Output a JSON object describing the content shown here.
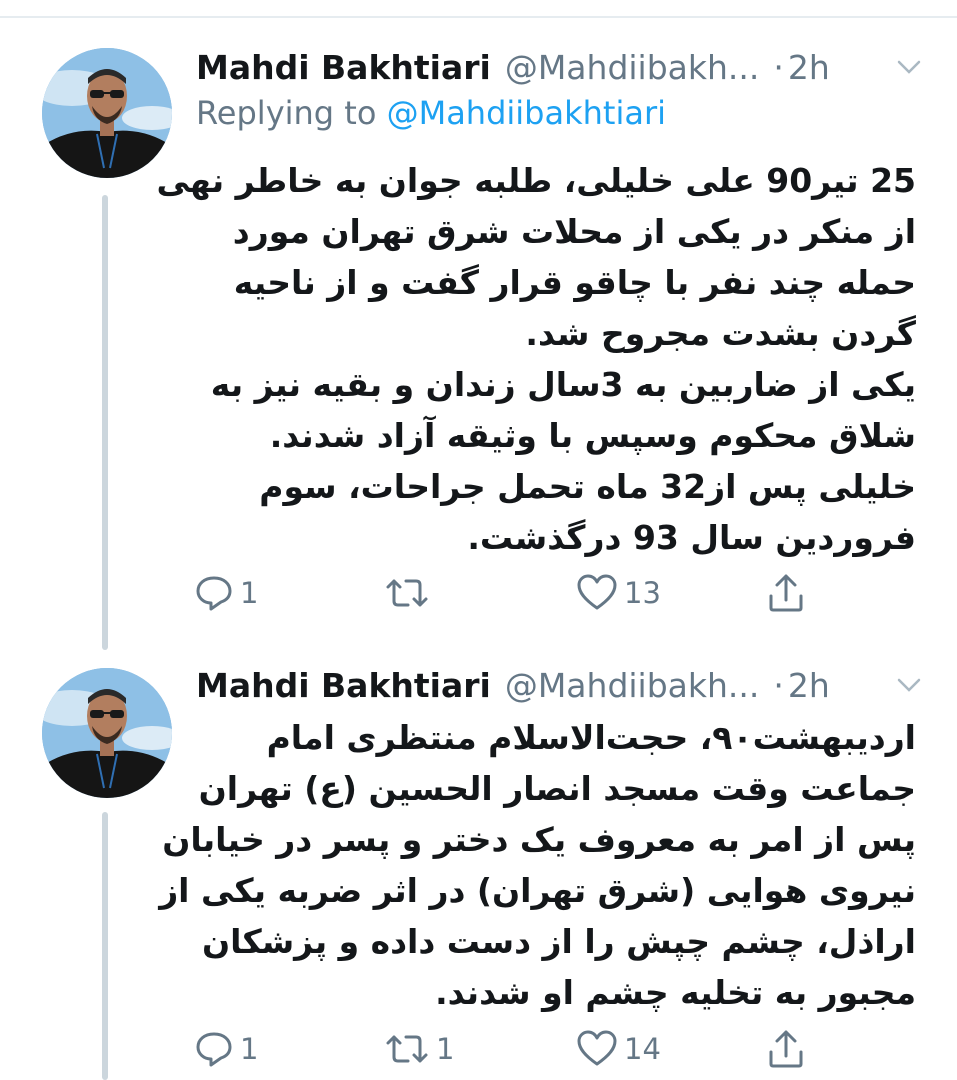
{
  "tweets": [
    {
      "author_name": "Mahdi Bakhtiari",
      "handle": "@Mahdiibakh...",
      "separator": "·",
      "time": "2h",
      "replying_prefix": "Replying to",
      "replying_to": "@Mahdiibakhtiari",
      "text_lines": [
        "25 تیر90 علی خلیلی، طلبه جوان به خاطر نهی",
        "از منکر در یکی از محلات شرق تهران مورد",
        "حمله چند نفر با چاقو قرار گفت و از ناحیه",
        "گردن بشدت مجروح شد.",
        "یکی از ضاربین به 3سال زندان و بقیه نیز به",
        "شلاق محکوم وسپس با وثیقه آزاد شدند.",
        "خلیلی پس از32 ماه تحمل جراحات، سوم",
        "فروردین سال 93 درگذشت."
      ],
      "replies": "1",
      "retweets": "",
      "likes": "13"
    },
    {
      "author_name": "Mahdi Bakhtiari",
      "handle": "@Mahdiibakh...",
      "separator": "·",
      "time": "2h",
      "text_lines": [
        "اردیبهشت۹۰، حجت‌الاسلام منتظری امام",
        "جماعت وقت مسجد انصار الحسین (ع) تهران",
        "پس از امر به معروف یک دختر و پسر در خیابان",
        "نیروی هوایی (شرق تهران) در اثر ضربه یکی از",
        "اراذل، چشم چپش را از دست داده و پزشکان",
        "مجبور به تخلیه چشم او شدند."
      ],
      "replies": "1",
      "retweets": "1",
      "likes": "14"
    }
  ],
  "icons": {
    "reply": "reply-icon",
    "retweet": "retweet-icon",
    "like": "heart-icon",
    "share": "share-icon",
    "more": "chevron-down-icon"
  },
  "colors": {
    "name": "#14171a",
    "secondary": "#657786",
    "link": "#1da1f2",
    "thread_line": "#ccd6dd"
  }
}
